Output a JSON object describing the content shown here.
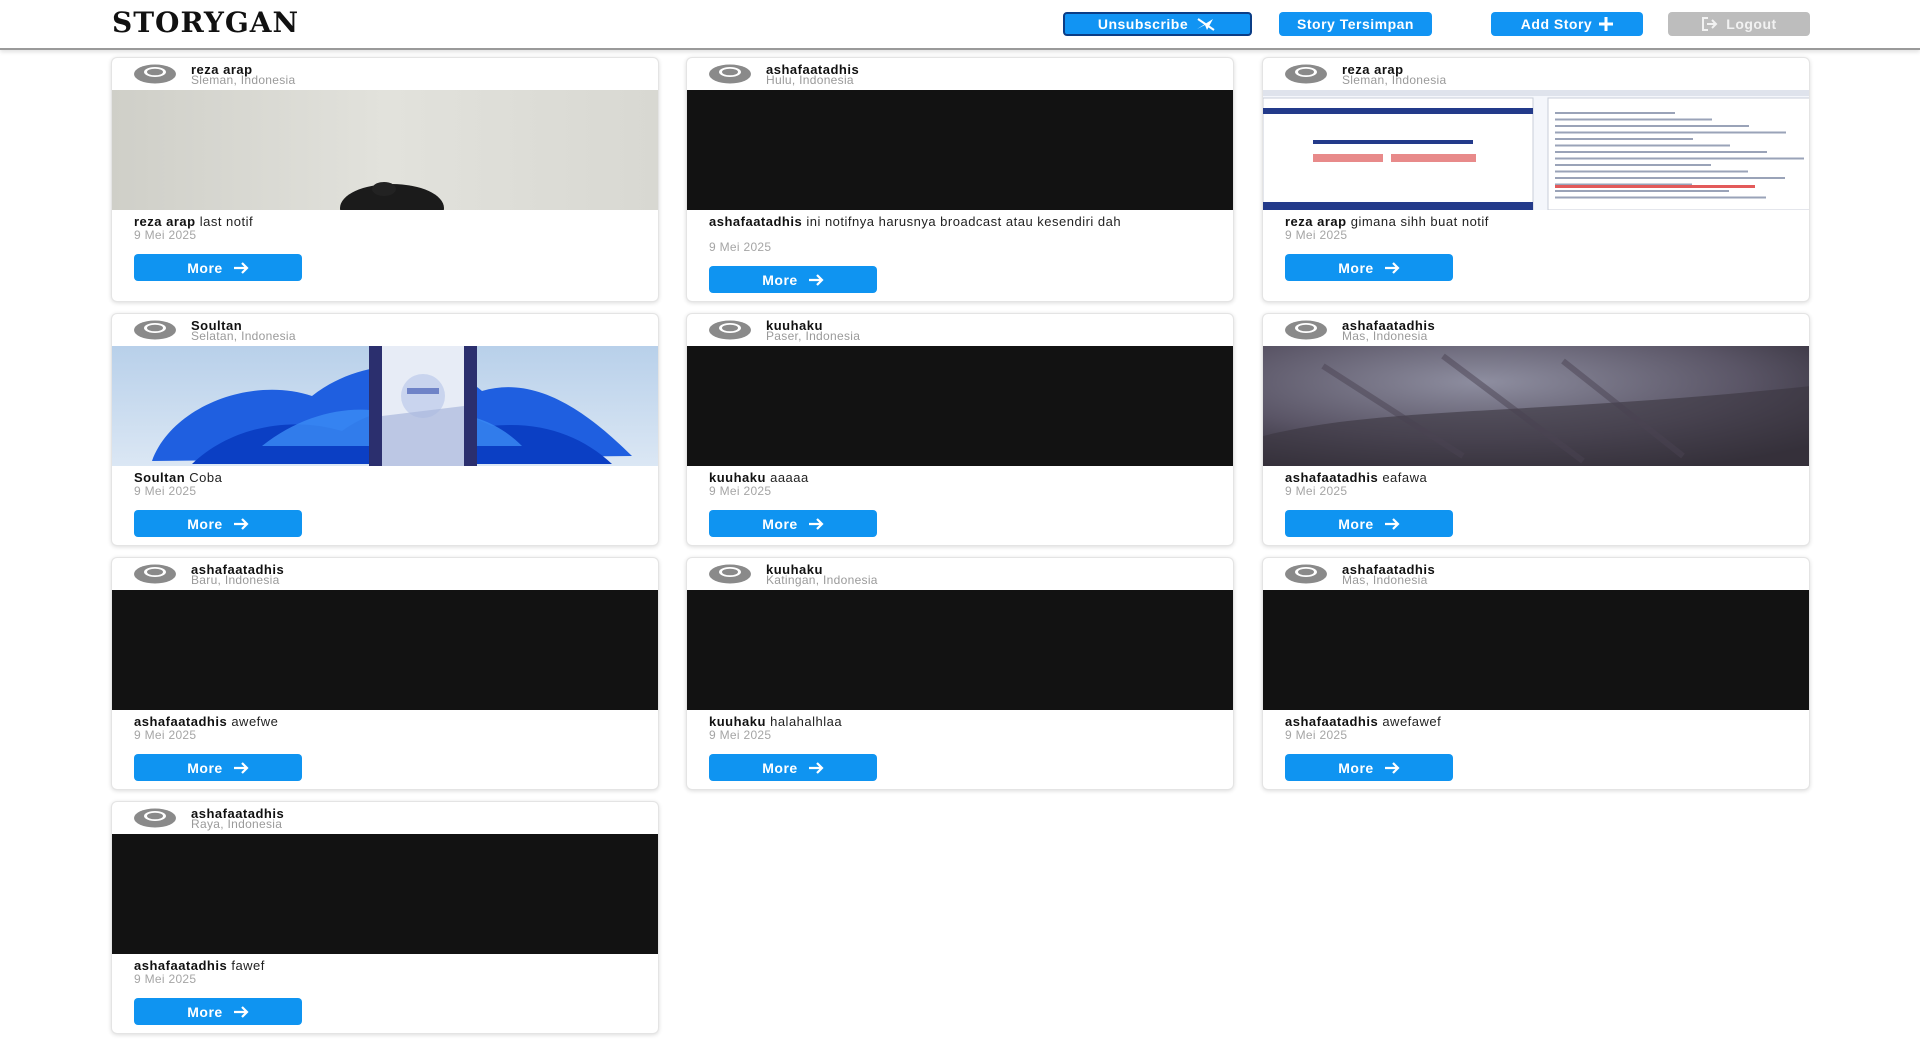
{
  "app": {
    "logo": "STORYGAN"
  },
  "nav": {
    "unsubscribe_label": "Unsubscribe",
    "saved_label": "Story Tersimpan",
    "add_label": "Add Story",
    "logout_label": "Logout"
  },
  "colors": {
    "accent": "#1194f3",
    "logout": "#bdbdbd",
    "dark_thumb": "#121212"
  },
  "stories": [
    {
      "author": "reza arap",
      "location": "Sleman, Indonesia",
      "caption": "last notif",
      "date": "9 Mei 2025",
      "more": "More",
      "image": "wall-photo"
    },
    {
      "author": "ashafaatadhis",
      "location": "Hulu, Indonesia",
      "caption": "ini notifnya harusnya broadcast atau kesendiri dah",
      "date": "9 Mei 2025",
      "more": "More",
      "image": "dark"
    },
    {
      "author": "reza arap",
      "location": "Sleman, Indonesia",
      "caption": "gimana sihh buat notif",
      "date": "9 Mei 2025",
      "more": "More",
      "image": "screenshot"
    },
    {
      "author": "Soultan",
      "location": "Selatan, Indonesia",
      "caption": "Coba",
      "date": "9 Mei 2025",
      "more": "More",
      "image": "blue-bloom"
    },
    {
      "author": "kuuhaku",
      "location": "Paser, Indonesia",
      "caption": "aaaaa",
      "date": "9 Mei 2025",
      "more": "More",
      "image": "dark"
    },
    {
      "author": "ashafaatadhis",
      "location": "Mas, Indonesia",
      "caption": "eafawa",
      "date": "9 Mei 2025",
      "more": "More",
      "image": "blurry-photo"
    },
    {
      "author": "ashafaatadhis",
      "location": "Baru, Indonesia",
      "caption": "awefwe",
      "date": "9 Mei 2025",
      "more": "More",
      "image": "dark"
    },
    {
      "author": "kuuhaku",
      "location": "Katingan, Indonesia",
      "caption": "halahalhlaa",
      "date": "9 Mei 2025",
      "more": "More",
      "image": "dark"
    },
    {
      "author": "ashafaatadhis",
      "location": "Mas, Indonesia",
      "caption": "awefawef",
      "date": "9 Mei 2025",
      "more": "More",
      "image": "dark"
    },
    {
      "author": "ashafaatadhis",
      "location": "Raya, Indonesia",
      "caption": "fawef",
      "date": "9 Mei 2025",
      "more": "More",
      "image": "dark"
    }
  ]
}
